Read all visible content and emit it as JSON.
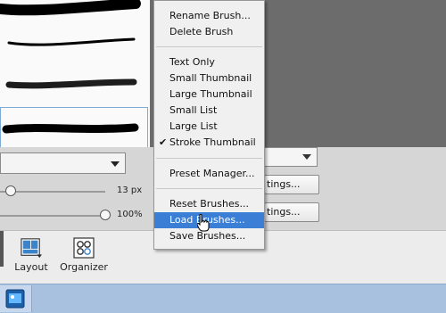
{
  "menu": {
    "items_top": [
      "Rename Brush...",
      "Delete Brush"
    ],
    "view_items": [
      "Text Only",
      "Small Thumbnail",
      "Large Thumbnail",
      "Small List",
      "Large List",
      "Stroke Thumbnail"
    ],
    "checked_view": "Stroke Thumbnail",
    "preset_manager": "Preset Manager...",
    "items_bottom": [
      "Reset Brushes...",
      "Load Brushes...",
      "Save Brushes..."
    ],
    "highlighted": "Load Brushes..."
  },
  "options": {
    "size_value": "13 px",
    "opacity_value": "100%",
    "settings_button_1": "tings...",
    "settings_button_2": "tings..."
  },
  "toolbar": {
    "layout_label": "Layout",
    "organizer_label": "Organizer"
  },
  "colors": {
    "menu_highlight": "#3a7fd5",
    "taskbar": "#a8c1de"
  }
}
